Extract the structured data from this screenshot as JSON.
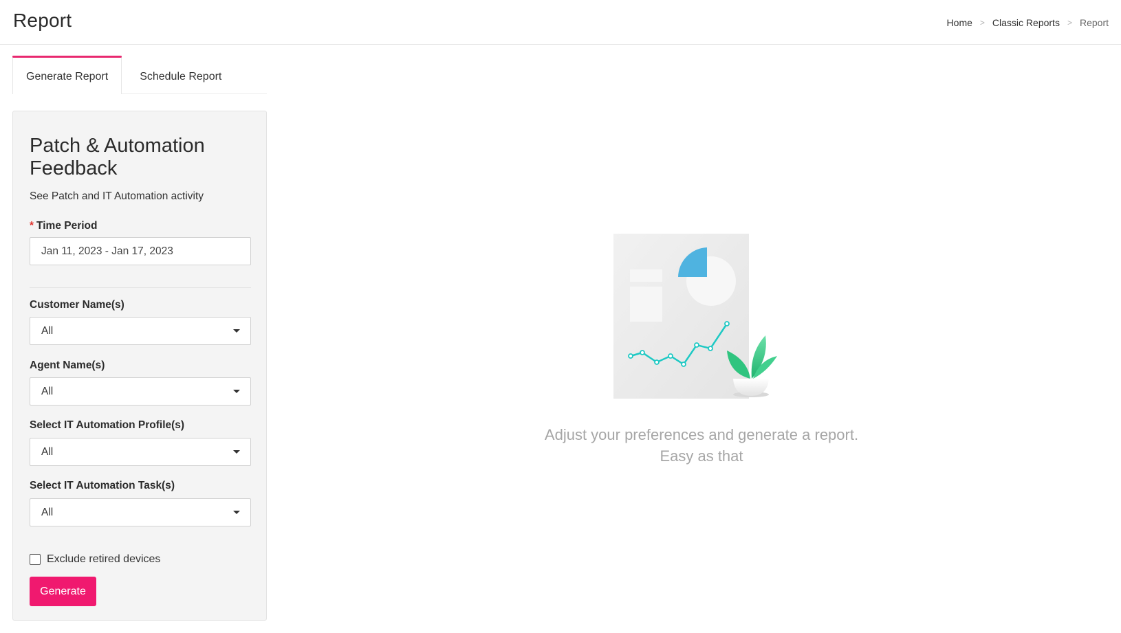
{
  "header": {
    "title": "Report",
    "breadcrumb": [
      {
        "label": "Home"
      },
      {
        "label": "Classic Reports"
      },
      {
        "label": "Report"
      }
    ],
    "separator": ">"
  },
  "tabs": [
    {
      "label": "Generate Report",
      "active": true
    },
    {
      "label": "Schedule Report",
      "active": false
    }
  ],
  "panel": {
    "title": "Patch & Automation Feedback",
    "subtitle": "See Patch and IT Automation activity",
    "time_period": {
      "label": "Time Period",
      "required_marker": "*",
      "value": "Jan 11, 2023 - Jan 17, 2023"
    },
    "customer": {
      "label": "Customer Name(s)",
      "value": "All"
    },
    "agent": {
      "label": "Agent Name(s)",
      "value": "All"
    },
    "profile": {
      "label": "Select IT Automation Profile(s)",
      "value": "All"
    },
    "task": {
      "label": "Select IT Automation Task(s)",
      "value": "All"
    },
    "exclude_retired": {
      "label": "Exclude retired devices",
      "checked": false
    },
    "generate_label": "Generate"
  },
  "empty_state": {
    "line1": "Adjust your preferences and generate a report.",
    "line2": "Easy as that",
    "illustration": "report-chart-with-plant"
  },
  "colors": {
    "accent": "#f0196f",
    "tab_indicator": "#e8286f",
    "chart_line": "#1ec9c4",
    "pie": "#4fb3e0",
    "plant": "#3ecf8e"
  }
}
